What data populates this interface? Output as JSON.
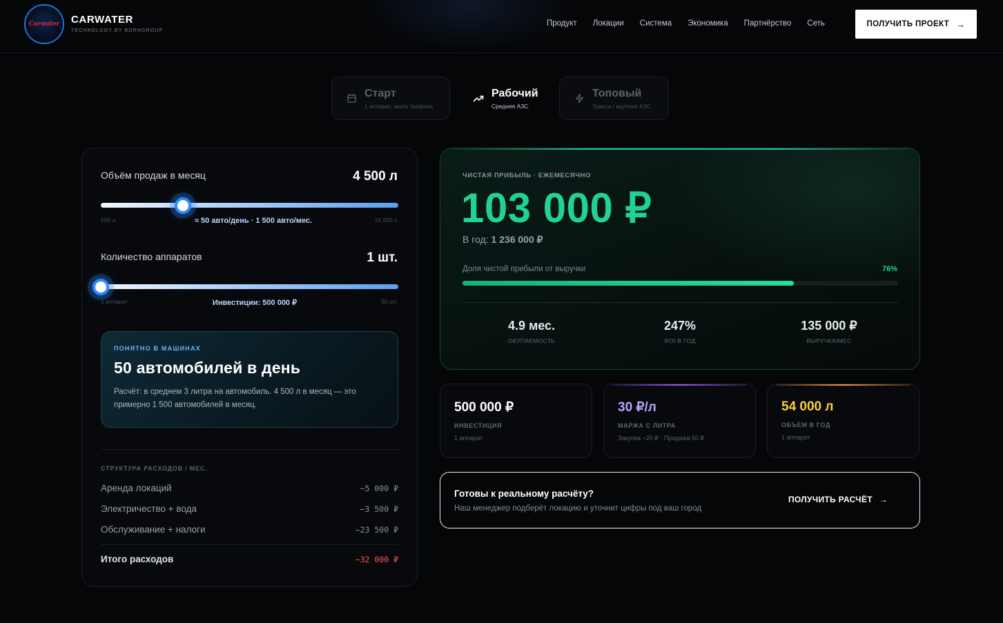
{
  "brand": {
    "logo_text": "Carwater",
    "name": "CARWATER",
    "subtitle": "TECHNOLOGY BY BORNGROUP"
  },
  "nav": {
    "items": [
      "Продукт",
      "Локации",
      "Система",
      "Экономика",
      "Партнёрство",
      "Сеть"
    ],
    "cta_label": "ПОЛУЧИТЬ ПРОЕКТ"
  },
  "tiers": [
    {
      "title": "Старт",
      "subtitle": "1 аппарат, мало трафика",
      "icon": "calendar-icon",
      "active": false
    },
    {
      "title": "Рабочий",
      "subtitle": "Средняя АЗС",
      "icon": "trend-up-icon",
      "active": true
    },
    {
      "title": "Топовый",
      "subtitle": "Трасса / крупная АЗС",
      "icon": "lightning-icon",
      "active": false
    }
  ],
  "calculator": {
    "volume": {
      "label": "Объём продаж в месяц",
      "value": "4 500 л",
      "min_label": "500 л",
      "max_label": "15 000 л",
      "note": "≈ 50 авто/день · 1 500 авто/мес.",
      "min": 500,
      "max": 15000,
      "current": 4500
    },
    "units": {
      "label": "Количество аппаратов",
      "value": "1 шт.",
      "min_label": "1 аппарат",
      "max_label": "50 шт.",
      "note": "Инвестиции: 500 000 ₽",
      "min": 1,
      "max": 50,
      "current": 1
    },
    "cars_card": {
      "kicker": "ПОНЯТНО В МАШИНАХ",
      "title": "50 автомобилей в день",
      "description": "Расчёт: в среднем 3 литра на автомобиль. 4 500 л в месяц — это примерно 1 500 автомобилей в месяц."
    },
    "expenses": {
      "heading": "СТРУКТУРА РАСХОДОВ / МЕС.",
      "rows": [
        {
          "label": "Аренда локаций",
          "value": "−5 000 ₽"
        },
        {
          "label": "Электричество + вода",
          "value": "−3 500 ₽"
        },
        {
          "label": "Обслуживание + налоги",
          "value": "−23 500 ₽"
        }
      ],
      "total_label": "Итого расходов",
      "total_value": "−32 000 ₽"
    }
  },
  "profit": {
    "kicker": "ЧИСТАЯ ПРИБЫЛЬ · ЕЖЕМЕСЯЧНО",
    "value": "103 000 ₽",
    "year_prefix": "В год:",
    "year_value": "1 236 000 ₽",
    "share_label": "Доля чистой прибыли от выручки",
    "share_pct_label": "76%",
    "share_fraction": 0.76,
    "stats": [
      {
        "value": "4.9 мес.",
        "label": "ОКУПАЕМОСТЬ"
      },
      {
        "value": "247%",
        "label": "ROI В ГОД"
      },
      {
        "value": "135 000 ₽",
        "label": "ВЫРУЧКА/МЕС"
      }
    ]
  },
  "mini_cards": [
    {
      "value": "500 000 ₽",
      "label": "ИНВЕСТИЦИЯ",
      "sub": "1 аппарат",
      "accent": "#ffffff"
    },
    {
      "value": "30 ₽/л",
      "label": "МАРЖА С ЛИТРА",
      "sub": "Закупка ~20 ₽ · Продажа 50 ₽",
      "accent": "#b9a3ff"
    },
    {
      "value": "54 000 л",
      "label": "ОБЪЁМ В ГОД",
      "sub": "1 аппарат",
      "accent": "#ffcf3d"
    }
  ],
  "bottom_cta": {
    "title": "Готовы к реальному расчёту?",
    "description": "Наш менеджер подберёт локацию и уточнит цифры под ваш город",
    "button_label": "ПОЛУЧИТЬ РАСЧЁТ"
  },
  "colors": {
    "profit_green": "#20d393",
    "slider_blue": "#2f8bff",
    "expense_red": "#ff5a5a"
  }
}
